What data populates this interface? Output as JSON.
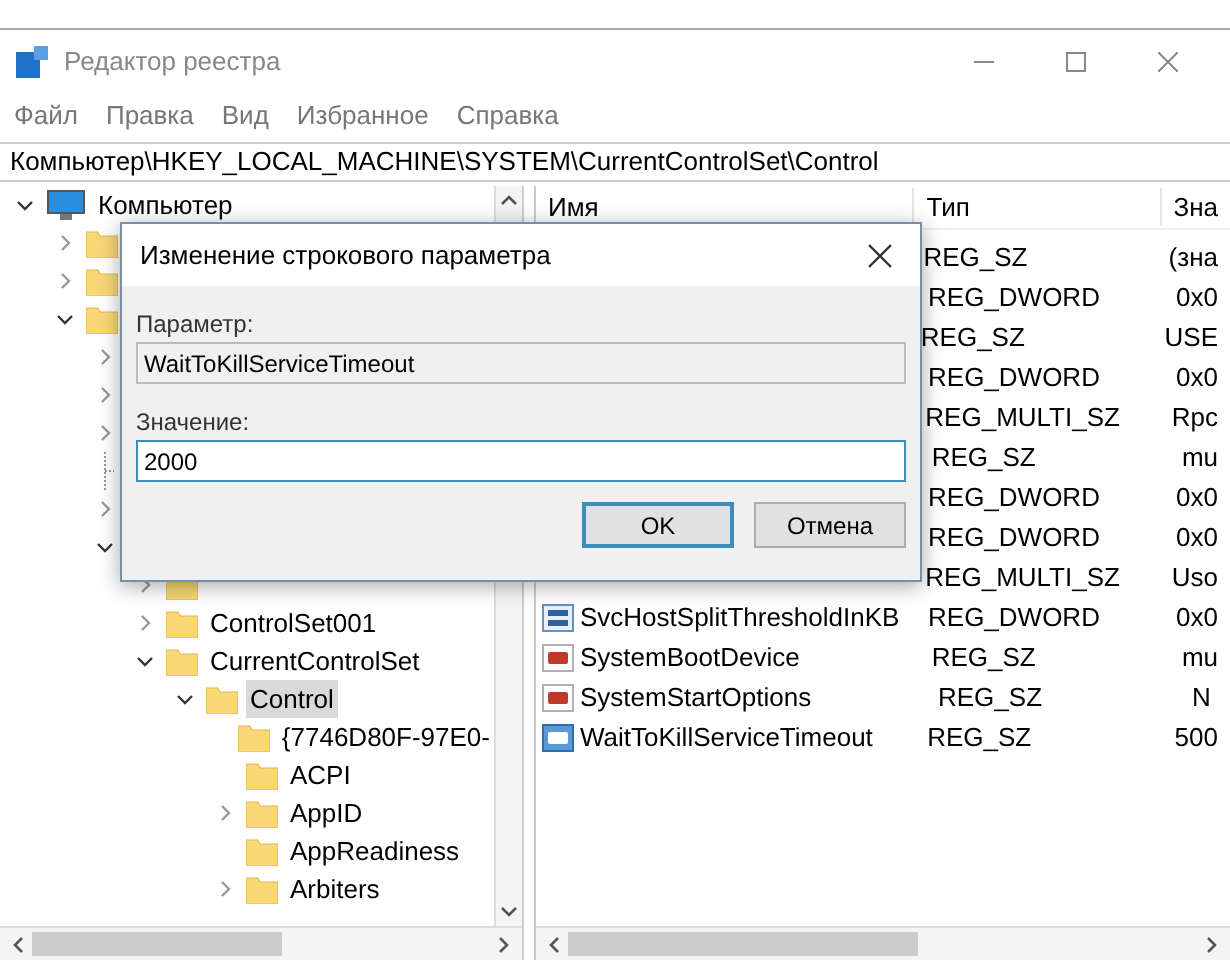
{
  "window": {
    "title": "Редактор реестра"
  },
  "menu": [
    "Файл",
    "Правка",
    "Вид",
    "Избранное",
    "Справка"
  ],
  "address": "Компьютер\\HKEY_LOCAL_MACHINE\\SYSTEM\\CurrentControlSet\\Control",
  "tree": [
    {
      "label": "Компьютер",
      "kind": "computer",
      "expanded": true,
      "selected": false,
      "children": [
        {
          "expanded": false
        },
        {
          "expanded": false
        },
        {
          "expanded": true,
          "children": [
            {
              "expanded": false
            },
            {
              "expanded": false
            },
            {
              "expanded": false
            },
            {
              "kind": "folder"
            },
            {
              "expanded": false
            },
            {
              "expanded": true,
              "children": [
                {
                  "expanded": false
                },
                {
                  "label": "ControlSet001",
                  "expanded": false,
                  "selected": false
                },
                {
                  "label": "CurrentControlSet",
                  "expanded": true,
                  "selected": false,
                  "children": [
                    {
                      "label": "Control",
                      "expanded": true,
                      "selected": true,
                      "children": [
                        {
                          "label": "{7746D80F-97E0-",
                          "selected": false
                        },
                        {
                          "label": "ACPI",
                          "selected": false
                        },
                        {
                          "label": "AppID",
                          "expanded": false,
                          "selected": false
                        },
                        {
                          "label": "AppReadiness",
                          "selected": false
                        },
                        {
                          "label": "Arbiters",
                          "expanded": false,
                          "selected": false
                        }
                      ]
                    }
                  ]
                }
              ]
            }
          ]
        }
      ]
    }
  ],
  "list": {
    "columns": [
      "Имя",
      "Тип",
      "Зна"
    ],
    "rows": [
      {
        "type": "REG_SZ",
        "value": "(зна"
      },
      {
        "type": "REG_DWORD",
        "value": "0x0"
      },
      {
        "type": "REG_SZ",
        "value": "USE"
      },
      {
        "type": "REG_DWORD",
        "value": "0x0"
      },
      {
        "type": "REG_MULTI_SZ",
        "value": "Rpc"
      },
      {
        "type": "REG_SZ",
        "value": "mu"
      },
      {
        "type": "REG_DWORD",
        "value": "0x0"
      },
      {
        "type": "REG_DWORD",
        "value": "0x0"
      },
      {
        "type": "REG_MULTI_SZ",
        "value": "Uso"
      },
      {
        "name": "SvcHostSplitThresholdInKB",
        "kind": "binary",
        "type": "REG_DWORD",
        "value": "0x0",
        "selected": false
      },
      {
        "name": "SystemBootDevice",
        "kind": "string",
        "type": "REG_SZ",
        "value": "mu",
        "selected": false
      },
      {
        "name": "SystemStartOptions",
        "kind": "string",
        "type": "REG_SZ",
        "value": "N",
        "selected": false
      },
      {
        "name": "WaitToKillServiceTimeout",
        "kind": "string",
        "type": "REG_SZ",
        "value": "500",
        "selected": true
      }
    ]
  },
  "dialog": {
    "title": "Изменение строкового параметра",
    "name_label": "Параметр:",
    "name_value": "WaitToKillServiceTimeout",
    "value_label": "Значение:",
    "value": "2000",
    "buttons": [
      {
        "label": "OK",
        "default": true
      },
      {
        "label": "Отмена",
        "default": false
      }
    ]
  }
}
